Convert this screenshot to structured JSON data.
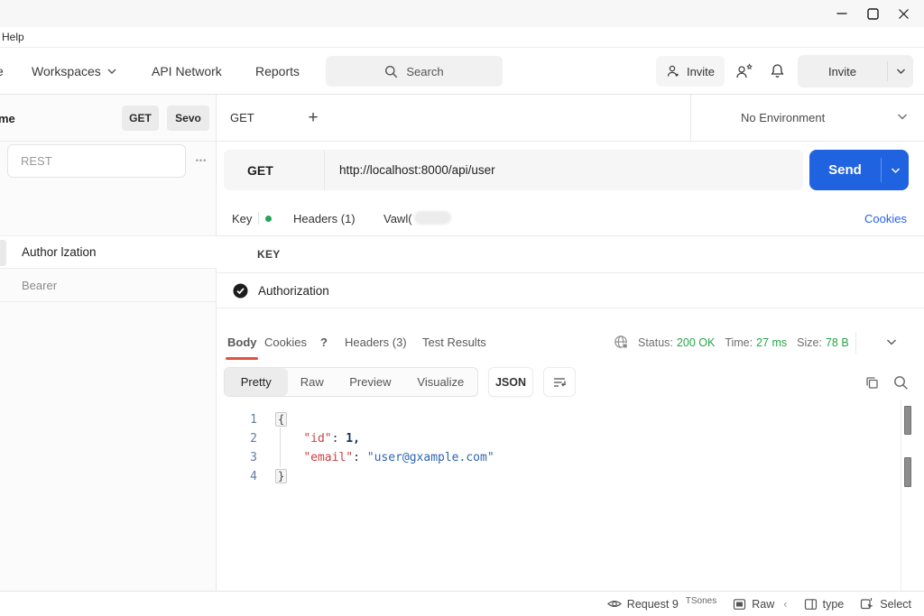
{
  "window": {
    "menubar_help": "Help"
  },
  "topnav": {
    "home_partial": "e",
    "workspaces": "Workspaces",
    "api_network": "API Network",
    "reports": "Reports",
    "search_placeholder": "Search",
    "invite_button": "Invite",
    "invite_split_button": "Invite"
  },
  "sidebar": {
    "header_partial": "me",
    "get_chip": "GET",
    "sevo_chip": "Sevo",
    "rest_value": "REST",
    "more_dots": "•••",
    "items": [
      {
        "label": "Author lzation",
        "active": true
      },
      {
        "label": "Bearer",
        "active": false
      }
    ]
  },
  "tabstrip": {
    "active_tab": "GET",
    "add_label": "+",
    "environment": "No Environment"
  },
  "request_bar": {
    "method": "GET",
    "url": "http://localhost:8000/api/user",
    "send": "Send"
  },
  "request_tabs": {
    "key_tab": "Key",
    "headers_tab": "Headers (1)",
    "vawl_tab": "Vawl(",
    "cookies_link": "Cookies"
  },
  "params_table": {
    "key_header": "KEY",
    "row_label": "Authorization"
  },
  "response": {
    "body_tab": "Body",
    "cookies_tab": "Cookies",
    "question_mark": "?",
    "headers_tab": "Headers (3)",
    "test_results_tab": "Test Results",
    "status_label": "Status:",
    "status_value": "200 OK",
    "time_label": "Time:",
    "time_value": "27 ms",
    "size_label": "Size:",
    "size_value": "78 B",
    "view_pretty": "Pretty",
    "view_raw": "Raw",
    "view_preview": "Preview",
    "view_visualize": "Visualize",
    "format_select": "JSON"
  },
  "code": {
    "lines": [
      {
        "num": "1",
        "tokens": [
          [
            "{",
            "brace"
          ]
        ]
      },
      {
        "num": "2",
        "tokens": [
          [
            "    ",
            "punct"
          ],
          [
            "\"id\"",
            "key"
          ],
          [
            ": ",
            "punct"
          ],
          [
            "1,",
            "number"
          ]
        ]
      },
      {
        "num": "3",
        "tokens": [
          [
            "    ",
            "punct"
          ],
          [
            "\"email\"",
            "key"
          ],
          [
            ": ",
            "punct"
          ],
          [
            "\"user@gxample.com\"",
            "string"
          ]
        ]
      },
      {
        "num": "4",
        "tokens": [
          [
            "}",
            "brace"
          ]
        ]
      }
    ]
  },
  "statusbar": {
    "request_label": "Request 9",
    "tsones_label": "TSones",
    "raw_label": "Raw",
    "back_chevron": "‹",
    "type_label": "type",
    "select_label": "Select"
  },
  "colors": {
    "send_blue": "#2063e0",
    "status_green": "#27a546",
    "accent_red": "#e0523f",
    "link_blue": "#2563eb",
    "key_red": "#cb4040",
    "string_blue": "#2e66b0",
    "number_dark": "#16325c",
    "line_number": "#5f7da0",
    "dot_green": "#23a558"
  }
}
